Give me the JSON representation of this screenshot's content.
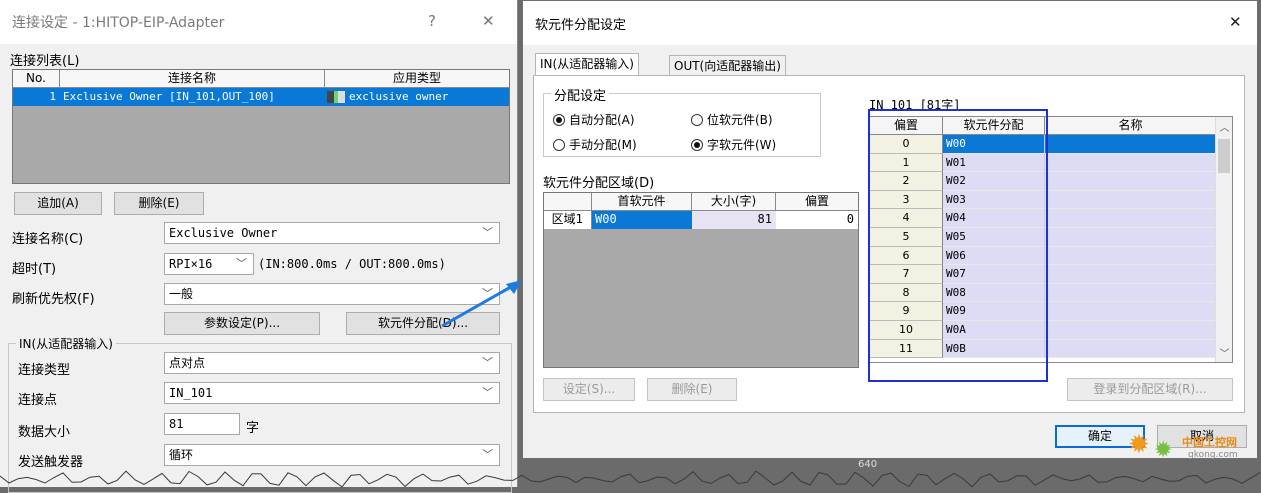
{
  "left": {
    "title": "连接设定 - 1:HITOP-EIP-Adapter",
    "help_glyph": "?",
    "close_glyph": "✕",
    "conn_list_label": "连接列表(L)",
    "conn_list": {
      "headers": [
        "No.",
        "连接名称",
        "应用类型"
      ],
      "rows": [
        {
          "no": "1",
          "name": "Exclusive Owner  [IN_101,OUT_100]",
          "type": "exclusive owner"
        }
      ]
    },
    "add_button": "追加(A)",
    "delete_button": "删除(E)",
    "conn_name_label": "连接名称(C)",
    "conn_name_value": "Exclusive Owner",
    "timeout_label": "超时(T)",
    "timeout_value": "RPI×16",
    "timeout_detail": "(IN:800.0ms / OUT:800.0ms)",
    "priority_label": "刷新优先权(F)",
    "priority_value": "一般",
    "param_button": "参数设定(P)...",
    "device_alloc_button": "软元件分配(D)...",
    "in_group_title": "IN(从适配器输入)",
    "conn_type_label": "连接类型",
    "conn_type_value": "点对点",
    "conn_point_label": "连接点",
    "conn_point_value": "IN_101",
    "data_size_label": "数据大小",
    "data_size_value": "81",
    "data_size_unit": "字",
    "trigger_label": "发送触发器",
    "trigger_value": "循环"
  },
  "right": {
    "title": "软元件分配设定",
    "close_glyph": "✕",
    "tabs": [
      "IN(从适配器输入)",
      "OUT(向适配器输出)"
    ],
    "alloc_group_title": "分配设定",
    "radios": [
      {
        "label": "自动分配(A)",
        "checked": true
      },
      {
        "label": "位软元件(B)",
        "checked": false
      },
      {
        "label": "手动分配(M)",
        "checked": false
      },
      {
        "label": "字软元件(W)",
        "checked": true
      }
    ],
    "area_label": "软元件分配区域(D)",
    "area_table": {
      "headers": [
        "",
        "首软元件",
        "大小(字)",
        "偏置"
      ],
      "rows": [
        {
          "area": "区域1",
          "start": "W00",
          "size": "81",
          "offset": "0"
        }
      ]
    },
    "set_button": "设定(S)...",
    "delete_button": "删除(E)",
    "in_label": "IN 101 [81字]",
    "dev_table": {
      "headers": [
        "偏置",
        "软元件分配",
        "名称"
      ],
      "rows": [
        {
          "offset": "0",
          "device": "W00"
        },
        {
          "offset": "1",
          "device": "W01"
        },
        {
          "offset": "2",
          "device": "W02"
        },
        {
          "offset": "3",
          "device": "W03"
        },
        {
          "offset": "4",
          "device": "W04"
        },
        {
          "offset": "5",
          "device": "W05"
        },
        {
          "offset": "6",
          "device": "W06"
        },
        {
          "offset": "7",
          "device": "W07"
        },
        {
          "offset": "8",
          "device": "W08"
        },
        {
          "offset": "9",
          "device": "W09"
        },
        {
          "offset": "10",
          "device": "W0A"
        },
        {
          "offset": "11",
          "device": "W0B"
        }
      ]
    },
    "register_button": "登录到分配区域(R)...",
    "ok_button": "确定",
    "cancel_button": "取消"
  },
  "bg_number": "640",
  "watermark": {
    "line1": "中国工控网",
    "line2": "gkong.com"
  },
  "colors": {
    "selection": "#0a78d7",
    "highlight_box": "#1d2fd6",
    "arrow": "#1e7be0"
  }
}
